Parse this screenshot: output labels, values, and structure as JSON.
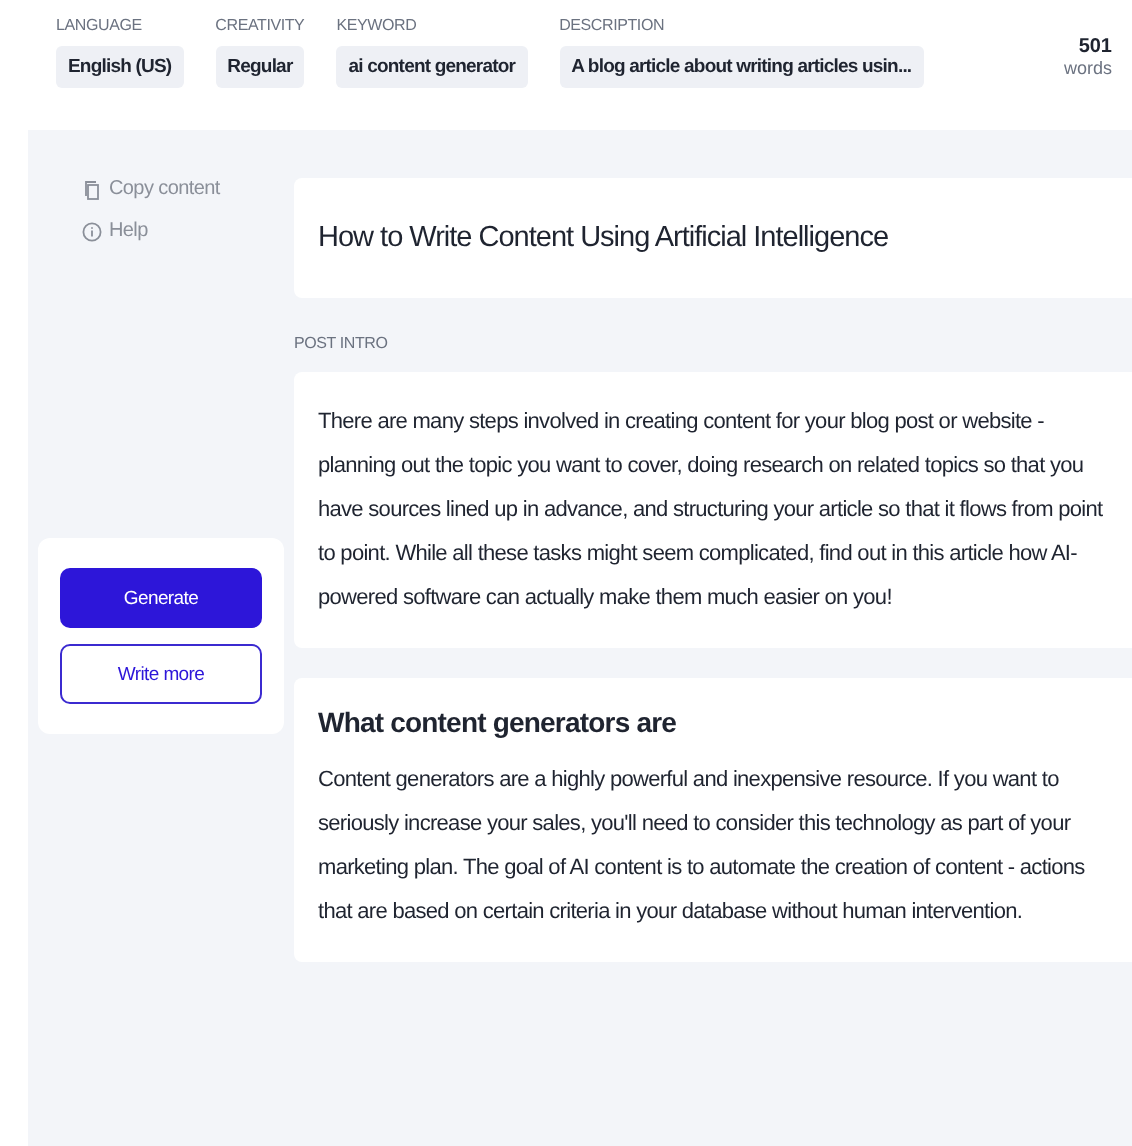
{
  "settings": [
    {
      "label": "LANGUAGE",
      "value": "English (US)"
    },
    {
      "label": "CREATIVITY",
      "value": "Regular"
    },
    {
      "label": "KEYWORD",
      "value": "ai content generator"
    },
    {
      "label": "DESCRIPTION",
      "value": "A blog article about writing articles usin..."
    }
  ],
  "word_count": {
    "value": "501",
    "unit": "words"
  },
  "side_actions": [
    {
      "kind": "copy",
      "label": "Copy content"
    },
    {
      "kind": "help",
      "label": "Help"
    }
  ],
  "buttons": [
    {
      "kind": "primary",
      "label": "Generate"
    },
    {
      "kind": "outline",
      "label": "Write more"
    }
  ],
  "title": "How to Write Content Using Artificial Intelligence",
  "sections": [
    {
      "label": "POST INTRO",
      "text": "There are many steps involved in creating content for your blog post or website - planning out the topic you want to cover, doing research on related topics so that you have sources lined up in advance, and structuring your article so that it flows from point to point. While all these tasks might seem complicated, find out in this article how AI-powered software can actually make them much easier on you!"
    },
    {
      "heading": "What content generators are",
      "text": "Content generators are a highly powerful and inexpensive resource. If you want to seriously increase your sales, you'll need to consider this technology as part of your marketing plan. The goal of AI content is to automate the creation of content - actions that are based on certain criteria in your database without human intervention."
    }
  ]
}
